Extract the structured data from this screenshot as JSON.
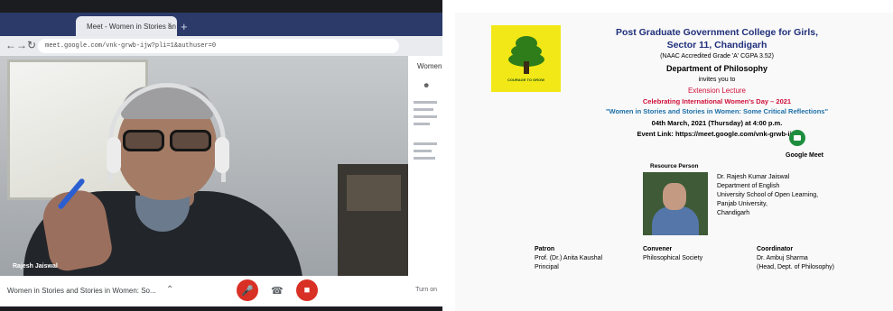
{
  "browser": {
    "tab_title": "Meet - Women in Stories an",
    "tab_close": "×",
    "new_tab": "+",
    "url": "meet.google.com/vnk-grwb-ijw?pli=1&authuser=0",
    "back_icon": "arrow-left-icon",
    "forward_icon": "arrow-right-icon",
    "reload_icon": "reload-icon"
  },
  "meet": {
    "participant_name": "Rajesh Jaiswal",
    "side_panel_title": "Women",
    "meeting_title": "Women in Stories and Stories in Women: So...",
    "more_text": "Turn on",
    "colors": {
      "end_red": "#d93025",
      "chrome_blue": "#2c3a6a"
    }
  },
  "invite": {
    "college_line1": "Post Graduate Government College for Girls,",
    "college_line2": "Sector 11, Chandigarh",
    "naac": "(NAAC Accredited Grade 'A' CGPA 3.52)",
    "department": "Department of Philosophy",
    "invites": "invites you to",
    "event_type": "Extension Lecture",
    "celebrating": "Celebrating International Women's Day – 2021",
    "talk_title": "\"Women in Stories and Stories in Women: Some Critical Reflections\"",
    "date": "04th March, 2021 (Thursday) at 4:00 p.m.",
    "event_link": "Event Link: https://meet.google.com/vnk-grwb-ijw",
    "google_meet_label": "Google Meet",
    "logo_caption": "COURAGE TO GROW",
    "resource_person_heading": "Resource Person",
    "resource_person": [
      "Dr. Rajesh Kumar Jaiswal",
      "Department of English",
      "University School of Open Learning,",
      "Panjab University,",
      "Chandigarh"
    ],
    "patron_heading": "Patron",
    "patron": [
      "Prof. (Dr.) Anita Kaushal",
      "Principal"
    ],
    "convener_heading": "Convener",
    "convener": [
      "Philosophical Society"
    ],
    "coordinator_heading": "Coordinator",
    "coordinator": [
      "Dr. Ambuj Sharma",
      "(Head, Dept. of Philosophy)"
    ],
    "colors": {
      "logo_yellow": "#f2e817",
      "navy": "#1f2f7a",
      "red": "#d0103a",
      "teal": "#1d6fa8"
    }
  }
}
